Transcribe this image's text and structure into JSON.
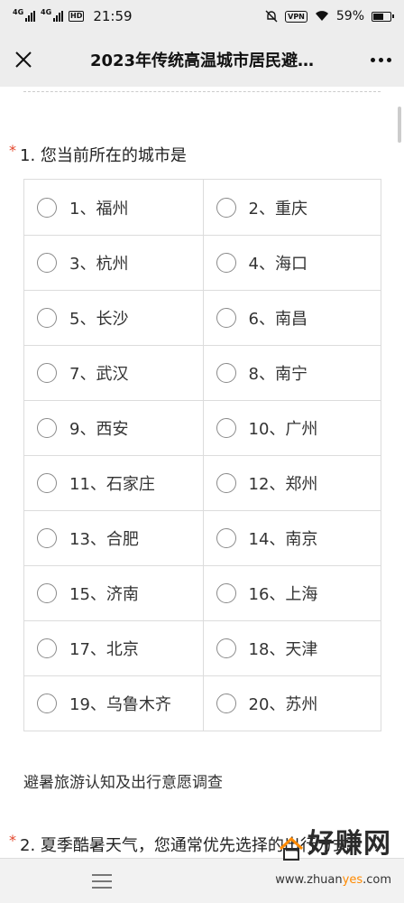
{
  "status_bar": {
    "signal1": "4G",
    "signal2": "4G",
    "time": "21:59",
    "vpn": "VPN",
    "battery": "59%",
    "battery_level": 0.59
  },
  "header": {
    "title": "2023年传统高温城市居民避…"
  },
  "question1": {
    "required_mark": "*",
    "title": "1. 您当前所在的城市是",
    "options": [
      "1、福州",
      "2、重庆",
      "3、杭州",
      "4、海口",
      "5、长沙",
      "6、南昌",
      "7、武汉",
      "8、南宁",
      "9、西安",
      "10、广州",
      "11、石家庄",
      "12、郑州",
      "13、合肥",
      "14、南京",
      "15、济南",
      "16、上海",
      "17、北京",
      "18、天津",
      "19、乌鲁木齐",
      "20、苏州"
    ]
  },
  "section": {
    "text": "避暑旅游认知及出行意愿调查"
  },
  "question2": {
    "required_mark": "*",
    "title": "2. 夏季酷暑天气，您通常优先选择的出行方式"
  },
  "watermark": {
    "text": "好赚网",
    "url_prefix": "www.zhuan",
    "url_highlight": "yes",
    "url_suffix": ".com"
  },
  "icons": {
    "close": "close-icon",
    "more": "more-icon",
    "menu": "menu-icon"
  }
}
